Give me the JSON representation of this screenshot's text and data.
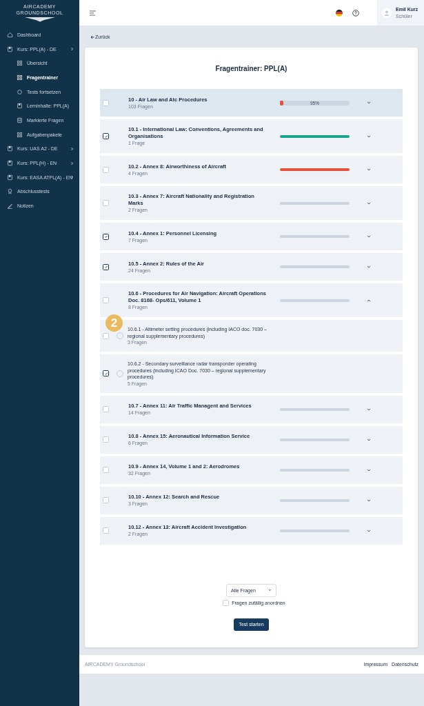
{
  "logo": {
    "line_1": "AIRCADEMY",
    "line_2": "GROUNDSCHOOL"
  },
  "sidebar": {
    "items": [
      {
        "label": "Dashboard",
        "kind": "home",
        "selected": false
      },
      {
        "label": "Kurs: PPL(A) - DE",
        "kind": "course",
        "selected": false,
        "children": [
          {
            "label": "Übersicht",
            "kind": "grid",
            "selected": false
          },
          {
            "label": "Fragentrainer",
            "kind": "grid",
            "selected": true
          },
          {
            "label": "Tests fortsetzen",
            "kind": "circle",
            "selected": false
          },
          {
            "label": "Lerninhalte: PPL(A)",
            "kind": "course",
            "selected": false
          },
          {
            "label": "Markierte Fragen",
            "kind": "bookmark",
            "selected": false
          },
          {
            "label": "Aufgabenpakete",
            "kind": "grid",
            "selected": false
          }
        ]
      },
      {
        "label": "Kurs: UAS A2 - DE",
        "kind": "course",
        "selected": false
      },
      {
        "label": "Kurs: PPL(H) - EN",
        "kind": "course",
        "selected": false
      },
      {
        "label": "Kurs: EASA ATPL(A) - EN",
        "kind": "course",
        "selected": false
      },
      {
        "label": "Abschlusstests",
        "kind": "award",
        "selected": false
      },
      {
        "label": "Notizen",
        "kind": "pen",
        "selected": false
      }
    ]
  },
  "user": {
    "name": "Emil Kurz",
    "role": "Schüler"
  },
  "back_link": "Zurück",
  "title": "Fragentrainer: PPL(A)",
  "rows": [
    {
      "kind": "chapter",
      "title": "10 - Air Law and Atc Procedures",
      "count": "103 Fragen",
      "checked": false,
      "level": 0.05,
      "color": "#e4523f",
      "reading": "95%",
      "expanded": false
    },
    {
      "kind": "topic",
      "title": "10.1 - International Law: Conventions, Agreements and Organisations",
      "count": "1 Frage",
      "checked": true,
      "level": 1,
      "color": "#1aa68a",
      "expanded": false
    },
    {
      "kind": "topic",
      "title": "10.2 - Annex 8: Airworthiness of Aircraft",
      "count": "4 Fragen",
      "checked": false,
      "level": 1,
      "color": "#e4523f",
      "expanded": false
    },
    {
      "kind": "topic",
      "title": "10.3 - Annex 7: Aircraft Nationality and Registration Marks",
      "count": "2 Fragen",
      "checked": false,
      "level": 0,
      "expanded": false
    },
    {
      "kind": "topic",
      "title": "10.4 - Annex 1: Personnel Licensing",
      "count": "7 Fragen",
      "checked": true,
      "level": 0,
      "expanded": false
    },
    {
      "kind": "topic",
      "title": "10.5 - Annex 2: Rules of the Air",
      "count": "24 Fragen",
      "checked": true,
      "level": 0,
      "expanded": false
    },
    {
      "kind": "topic",
      "title": "10.6 - Procedures for Air Navigation: Aircraft Operations Doc. 8168- Ops/611, Volume 1",
      "count": "8 Fragen",
      "checked": false,
      "level": 0,
      "expanded": true
    },
    {
      "kind": "subtopic",
      "title": "10.6.1 - Altimeter setting procedures (including IACO doc. 7030 – regional supplementary procedures)",
      "count": "3 Fragen",
      "checked": false,
      "selected": false,
      "badge": "2"
    },
    {
      "kind": "subtopic",
      "title": "10.6.2 - Secondary surveillance radar transponder operating procedures (including ICAO Doc. 7030 – regional supplementary procedures)",
      "count": "5 Fragen",
      "checked": true,
      "selected": false
    },
    {
      "kind": "topic",
      "title": "10.7 - Annex 11: Air Traffic Managent and Services",
      "count": "14 Fragen",
      "checked": false,
      "level": 0,
      "expanded": false
    },
    {
      "kind": "topic",
      "title": "10.8 - Annex 15: Aeronautical Information Service",
      "count": "6 Fragen",
      "checked": false,
      "level": 0,
      "expanded": false
    },
    {
      "kind": "topic",
      "title": "10.9 - Annex 14, Volume 1 and 2: Aerodromes",
      "count": "32 Fragen",
      "checked": false,
      "level": 0,
      "expanded": false
    },
    {
      "kind": "topic",
      "title": "10.10 - Annex 12: Search and Rescue",
      "count": "3 Fragen",
      "checked": false,
      "level": 0,
      "expanded": false
    },
    {
      "kind": "topic",
      "title": "10.12 - Annex 13: Aircraft Accident Investigation",
      "count": "2 Fragen",
      "checked": false,
      "level": 0,
      "expanded": false
    }
  ],
  "filter": {
    "value": "Alle Fragen"
  },
  "shuffle": {
    "label": "Fragen zufällig anordnen",
    "checked": false
  },
  "start_button": "Test starten",
  "footer": {
    "brand": "AIRCADEMY Groundschool",
    "links": [
      "Impressum",
      "Datenschutz"
    ]
  }
}
